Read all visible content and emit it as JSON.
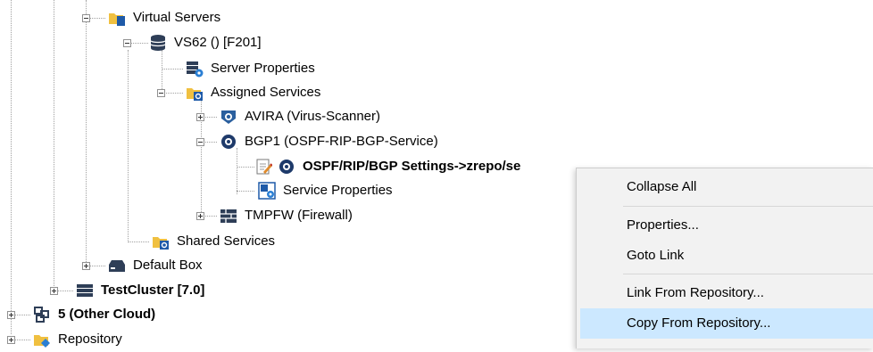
{
  "tree": {
    "virtual_servers": "Virtual Servers",
    "vs62": "VS62 () [F201]",
    "server_properties": "Server Properties",
    "assigned_services": "Assigned Services",
    "avira": "AVIRA (Virus-Scanner)",
    "bgp1": "BGP1 (OSPF-RIP-BGP-Service)",
    "ospf_settings": "OSPF/RIP/BGP Settings->zrepo/se",
    "service_properties": "Service Properties",
    "tmpfw": "TMPFW (Firewall)",
    "shared_services": "Shared Services",
    "default_box": "Default Box",
    "testcluster": "TestCluster [7.0]",
    "other_cloud": "5 (Other Cloud)",
    "repository": "Repository"
  },
  "context_menu": {
    "items": [
      {
        "label": "Collapse All"
      },
      {
        "label": "Properties..."
      },
      {
        "label": "Goto Link"
      },
      {
        "label": "Link From Repository..."
      },
      {
        "label": "Copy From Repository..."
      }
    ]
  },
  "colors": {
    "folder": "#f0c040",
    "blue_icon": "#1e5aa8",
    "dark_icon": "#2e3e57",
    "menu_bg": "#f2f2f2",
    "menu_highlight": "#cce8ff"
  }
}
